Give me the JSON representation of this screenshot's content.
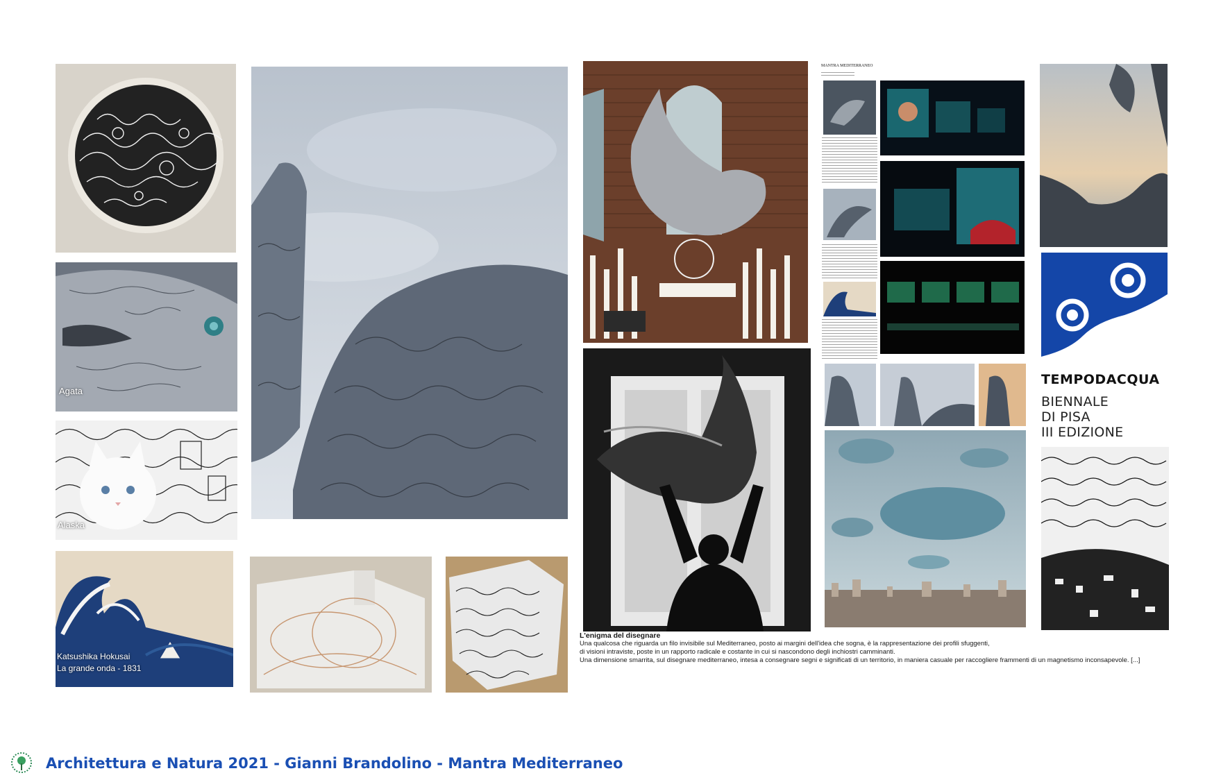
{
  "footer": {
    "title": "Architettura e Natura 2021 - Gianni Brandolino - Mantra Mediterraneo"
  },
  "captions": {
    "agata": "Agata",
    "alaska": "Alaska",
    "hokusai_line1": "Katsushika Hokusai",
    "hokusai_line2": "La grande onda - 1831"
  },
  "essay": {
    "title": "L'enigma del disegnare",
    "lines": [
      "Una qualcosa che riguarda un filo invisibile sul Mediterraneo, posto ai margini dell'idea che sogna, è la rappresentazione dei profili sfuggenti,",
      "di visioni intraviste, poste in un rapporto radicale e costante in cui si nascondono degli inchiostri camminanti.",
      "Una dimensione smarrita, sul disegnare mediterraneo, intesa a consegnare segni e significati di un territorio, in maniera casuale per raccogliere frammenti di un magnetismo inconsapevole. [...]"
    ]
  },
  "document": {
    "heading": "MANTRA MEDITERRANEO"
  },
  "brand": {
    "name": "TEMPODACQUA",
    "sub_lines": [
      "BIENNALE",
      "DI PISA",
      "III EDIZIONE"
    ],
    "logo_color": "#1446a8"
  },
  "colors": {
    "footer_text": "#1a4fb3",
    "sky": "#c9d1dc",
    "stone": "#6f7a88"
  }
}
